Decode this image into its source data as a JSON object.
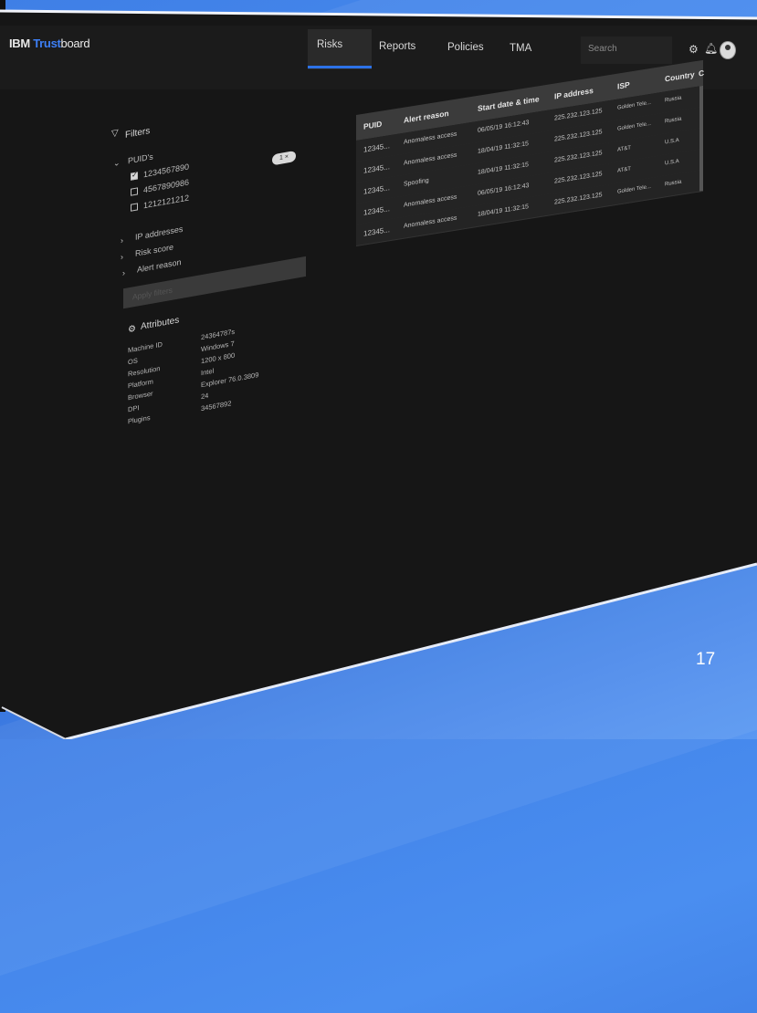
{
  "slide": {
    "number": "17"
  },
  "header": {
    "logo": {
      "brand": "IBM",
      "product_highlight": "Trust",
      "product_rest": "board"
    },
    "nav": [
      {
        "label": "Risks",
        "active": true
      },
      {
        "label": "Reports",
        "active": false
      },
      {
        "label": "Policies",
        "active": false
      },
      {
        "label": "TMA",
        "active": false
      }
    ],
    "search": {
      "placeholder": "Search"
    },
    "icons": [
      "gear-icon",
      "bell-icon",
      "avatar"
    ]
  },
  "filters": {
    "title": "Filters",
    "puid": {
      "label": "PUID's",
      "badge": "1 ×",
      "items": [
        {
          "label": "1234567890",
          "checked": true
        },
        {
          "label": "4567890986",
          "checked": false
        },
        {
          "label": "1212121212",
          "checked": false
        }
      ]
    },
    "collapsed": [
      {
        "label": "IP addresses"
      },
      {
        "label": "Risk score"
      },
      {
        "label": "Alert reason"
      }
    ],
    "apply_button": "Apply filters"
  },
  "attributes": {
    "title": "Attributes",
    "rows": [
      {
        "label": "Machine ID",
        "value": "24364787s"
      },
      {
        "label": "OS",
        "value": "Windows 7"
      },
      {
        "label": "Resolution",
        "value": "1200 x 800"
      },
      {
        "label": "Platform",
        "value": "Intel"
      },
      {
        "label": "Browser",
        "value": "Explorer 76.0.3809"
      },
      {
        "label": "DPI",
        "value": "24"
      },
      {
        "label": "Plugins",
        "value": "34567892"
      }
    ]
  },
  "table": {
    "columns": [
      "PUID",
      "Alert reason",
      "Start date & time",
      "IP address",
      "ISP",
      "Country",
      "C"
    ],
    "rows": [
      {
        "puid": "12345...",
        "reason": "Anomaless access",
        "start": "06/05/19  16:12:43",
        "ip": "225.232.123.125",
        "isp": "Golden Tele...",
        "country": "Russia"
      },
      {
        "puid": "12345...",
        "reason": "Anomaless access",
        "start": "18/04/19  11:32:15",
        "ip": "225.232.123.125",
        "isp": "Golden Tele...",
        "country": "Russia"
      },
      {
        "puid": "12345...",
        "reason": "Spoofing",
        "start": "18/04/19  11:32:15",
        "ip": "225.232.123.125",
        "isp": "AT&T",
        "country": "U.S.A"
      },
      {
        "puid": "12345...",
        "reason": "Anomaless access",
        "start": "06/05/19  16:12:43",
        "ip": "225.232.123.125",
        "isp": "AT&T",
        "country": "U.S.A"
      },
      {
        "puid": "12345...",
        "reason": "Anomaless access",
        "start": "18/04/19  11:32:15",
        "ip": "225.232.123.125",
        "isp": "Golden Tele...",
        "country": "Russia"
      }
    ]
  }
}
